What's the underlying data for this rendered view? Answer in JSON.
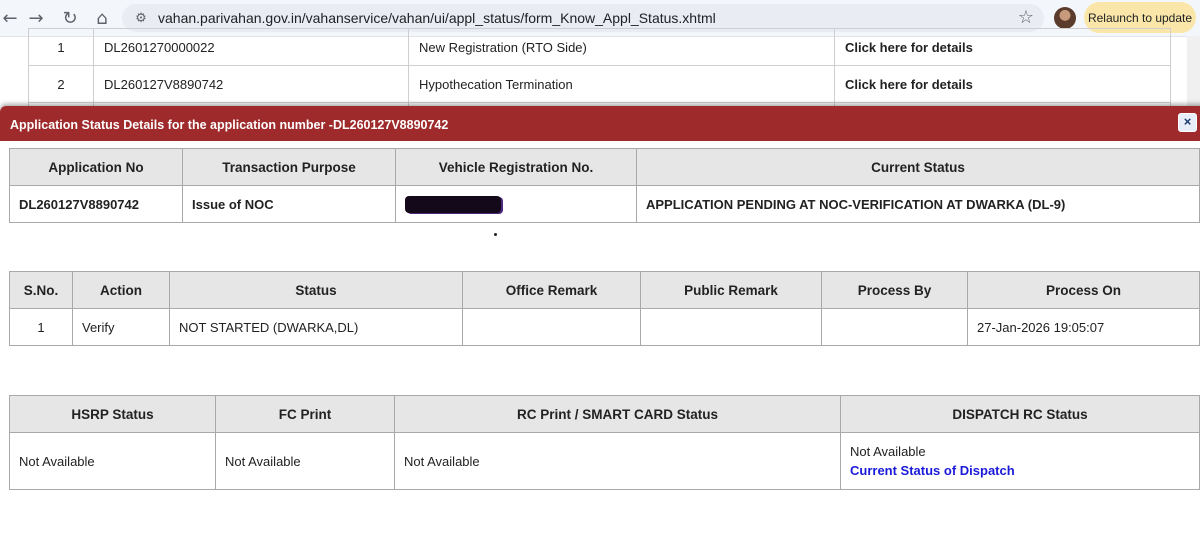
{
  "browser": {
    "url": "vahan.parivahan.gov.in/vahanservice/vahan/ui/appl_status/form_Know_Appl_Status.xhtml",
    "relaunch_label": "Relaunch to update",
    "icons": [
      "back-icon",
      "forward-icon",
      "reload-icon",
      "home-icon",
      "site-settings-icon",
      "bookmark-star-icon"
    ]
  },
  "background_page": {
    "rows": [
      {
        "sno": "1",
        "appl_no": "DL2601270000022",
        "purpose": "New Registration (RTO Side)",
        "link": "Click here for details"
      },
      {
        "sno": "2",
        "appl_no": "DL260127V8890742",
        "purpose": "Hypothecation Termination",
        "link": "Click here for details"
      }
    ]
  },
  "modal": {
    "title": "Application Status Details for the application number -DL260127V8890742",
    "close_label": "×",
    "summary": {
      "headers": [
        "Application No",
        "Transaction Purpose",
        "Vehicle Registration No.",
        "Current Status"
      ],
      "row": {
        "application_no": "DL260127V8890742",
        "transaction_purpose": "Issue of NOC",
        "vehicle_registration_no": "",
        "current_status": "APPLICATION PENDING AT NOC-VERIFICATION AT DWARKA (DL-9)"
      }
    },
    "actions": {
      "headers": [
        "S.No.",
        "Action",
        "Status",
        "Office Remark",
        "Public Remark",
        "Process By",
        "Process On"
      ],
      "rows": [
        {
          "sno": "1",
          "action": "Verify",
          "status": "NOT STARTED (DWARKA,DL)",
          "office_remark": "",
          "public_remark": "",
          "process_by": "",
          "process_on": "27-Jan-2026 19:05:07"
        }
      ]
    },
    "print_status": {
      "headers": [
        "HSRP Status",
        "FC Print",
        "RC Print / SMART CARD Status",
        "DISPATCH RC Status"
      ],
      "row": {
        "hsrp": "Not Available",
        "fc_print": "Not Available",
        "rc_print": "Not Available",
        "dispatch_text": "Not Available",
        "dispatch_link": "Current Status of Dispatch"
      }
    }
  }
}
